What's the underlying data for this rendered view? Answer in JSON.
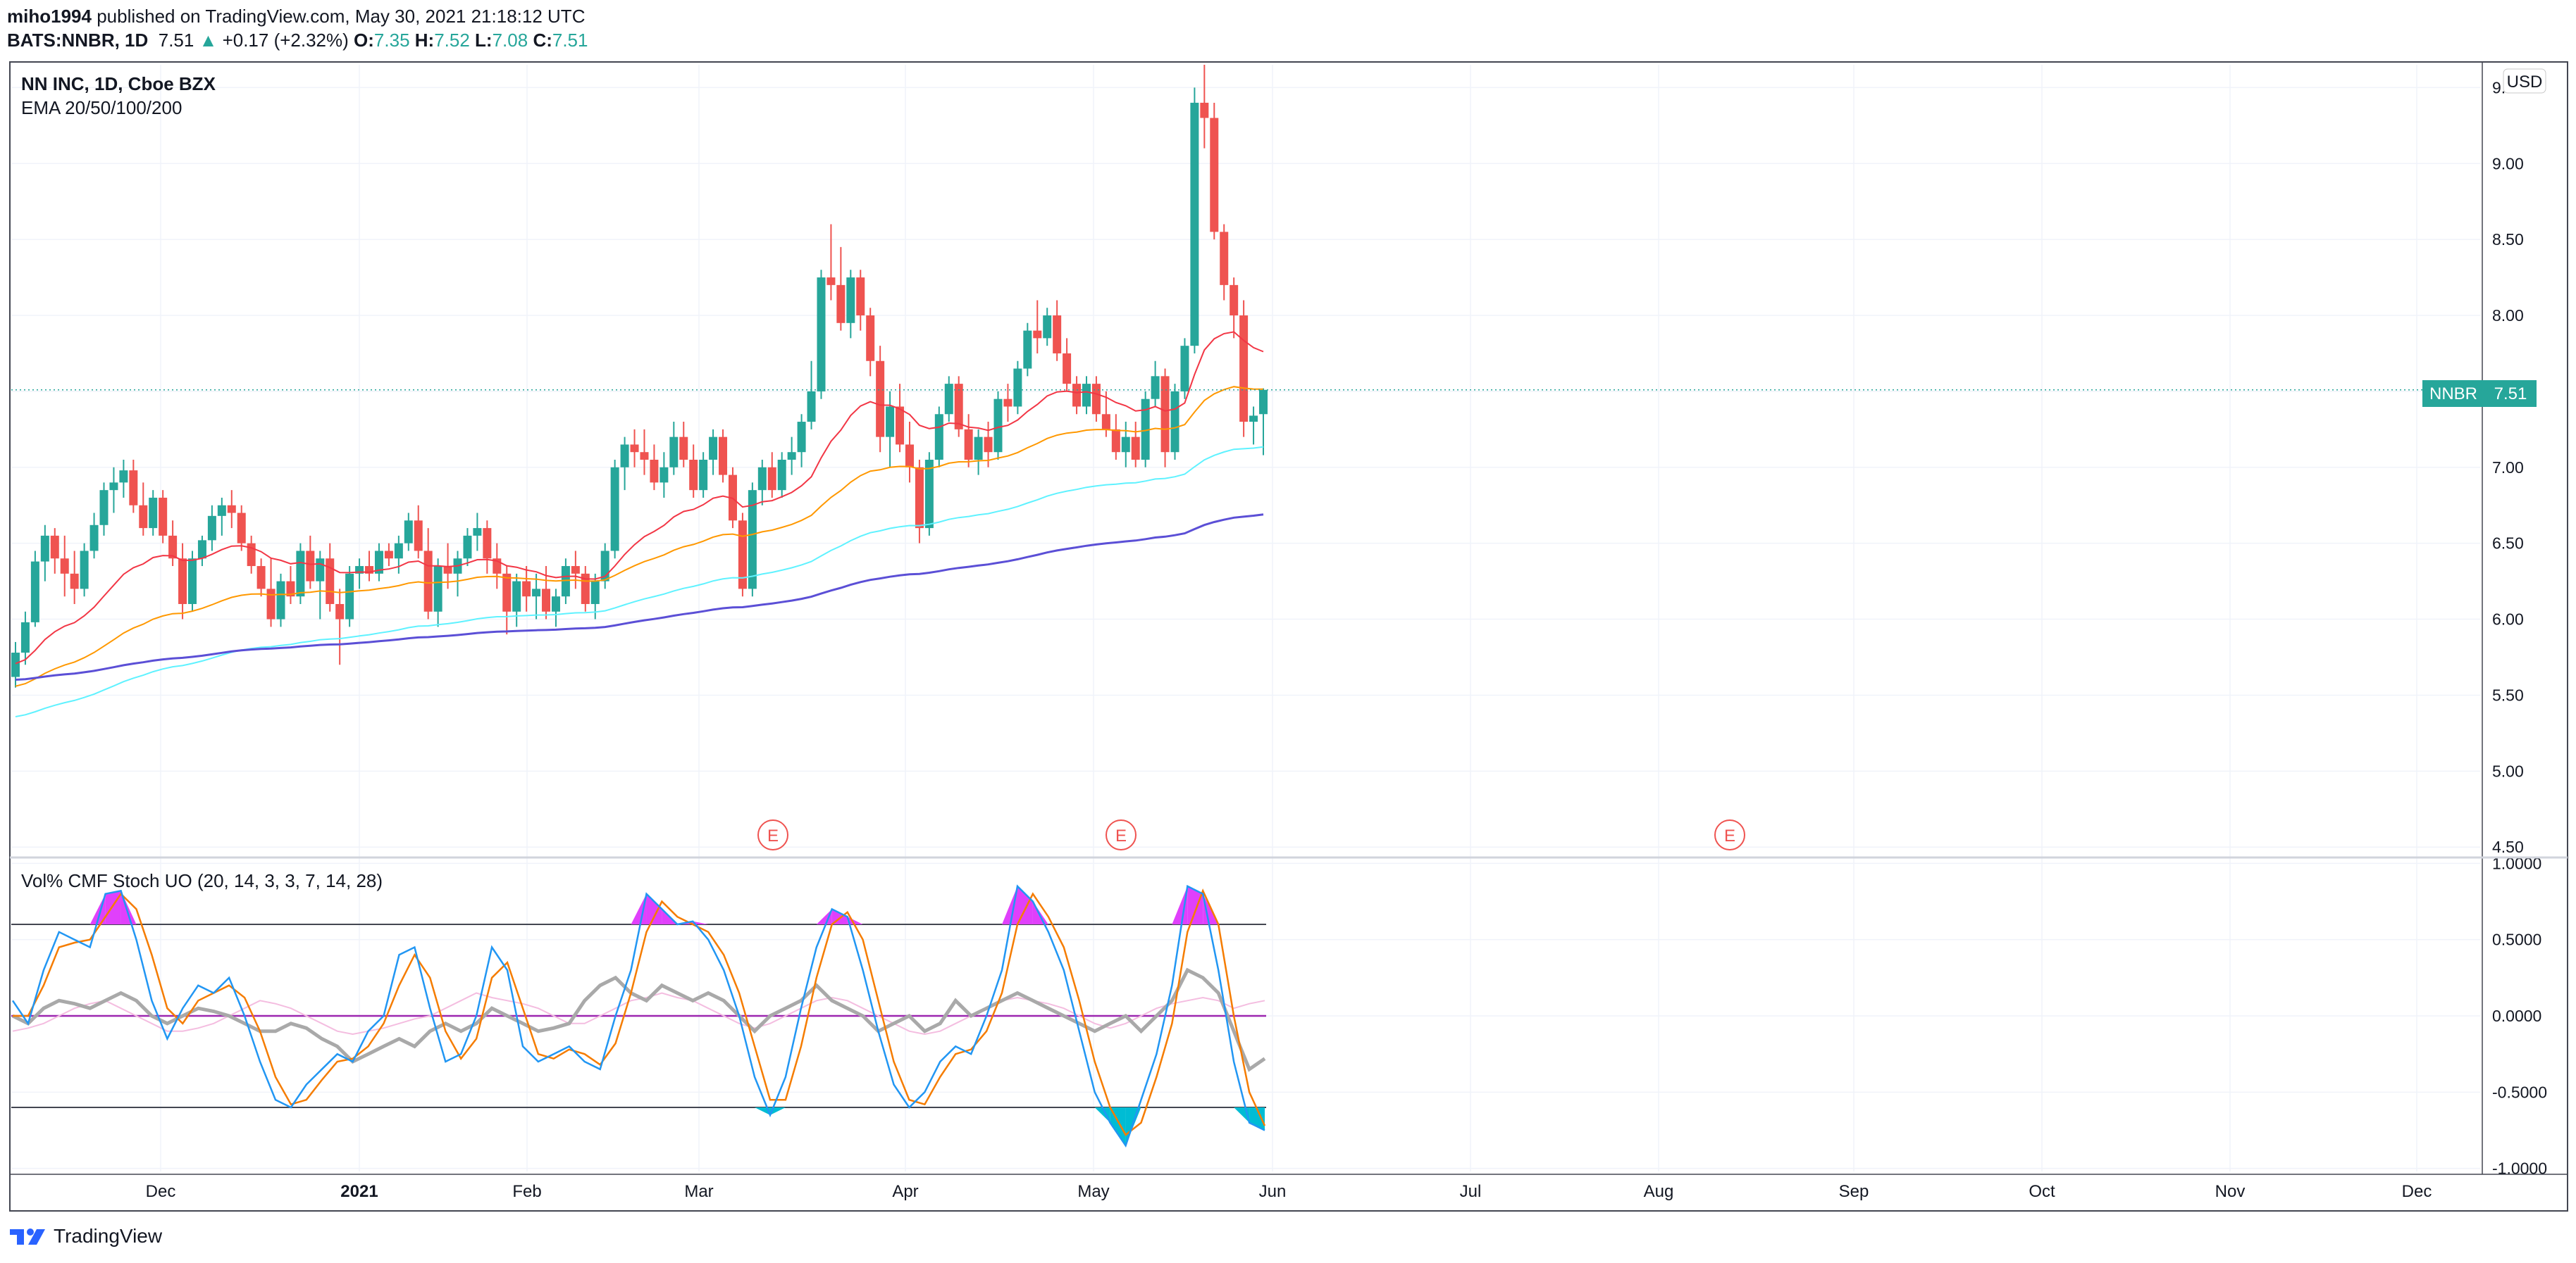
{
  "header": {
    "author": "miho1994",
    "published": "published on TradingView.com, May 30, 2021 21:18:12 UTC",
    "symbol": "BATS:NNBR, 1D",
    "last": "7.51",
    "arrow": "▲",
    "change": "+0.17 (+2.32%)",
    "o_label": "O:",
    "o_value": "7.35",
    "h_label": "H:",
    "h_value": "7.52",
    "l_label": "L:",
    "l_value": "7.08",
    "c_label": "C:",
    "c_value": "7.51"
  },
  "legend": {
    "title": "NN INC, 1D, Cboe BZX",
    "indicator": "EMA 20/50/100/200",
    "oscillator": "Vol% CMF Stoch UO (20, 14, 3, 3, 7, 14, 28)"
  },
  "currency": "USD",
  "price_tag": {
    "symbol": "NNBR",
    "value": "7.51"
  },
  "footer": {
    "brand": "TradingView"
  },
  "colors": {
    "up": "#26a69a",
    "down": "#ef5350",
    "ema20": "#f23645",
    "ema50": "#ff9800",
    "ema100": "#5ff2ff",
    "ema200": "#5b4fd6",
    "stoch_k": "#2196f3",
    "stoch_d": "#f57c00",
    "uo": "#a9a9a9",
    "cmf": "#f4bde0",
    "zero": "#9c27b0",
    "band": "#787b86",
    "overbought": "#e040fb",
    "oversold": "#00bcd4"
  },
  "chart_data": [
    {
      "type": "candlestick",
      "title": "NN INC, 1D, Cboe BZX",
      "y_ticks": [
        "4.50",
        "5.00",
        "5.50",
        "6.00",
        "6.50",
        "7.00",
        "7.50",
        "8.00",
        "8.50",
        "9.00",
        "9.50"
      ],
      "x_ticks": [
        "Dec",
        "2021",
        "Feb",
        "Mar",
        "Apr",
        "May",
        "Jun",
        "Jul",
        "Aug",
        "Sep",
        "Oct",
        "Nov",
        "Dec"
      ],
      "ylim": [
        4.45,
        9.65
      ],
      "earnings_markers": {
        "label": "E",
        "dates": [
          "2021-03-12",
          "2021-05-06",
          "2021-08-12"
        ]
      },
      "last_price": 7.51,
      "candles_approx": [
        [
          5.62,
          5.85,
          5.55,
          5.78
        ],
        [
          5.78,
          6.05,
          5.7,
          5.98
        ],
        [
          5.98,
          6.45,
          5.95,
          6.38
        ],
        [
          6.38,
          6.62,
          6.25,
          6.55
        ],
        [
          6.55,
          6.6,
          6.3,
          6.4
        ],
        [
          6.4,
          6.55,
          6.15,
          6.3
        ],
        [
          6.3,
          6.45,
          6.1,
          6.2
        ],
        [
          6.2,
          6.5,
          6.15,
          6.45
        ],
        [
          6.45,
          6.7,
          6.4,
          6.62
        ],
        [
          6.62,
          6.9,
          6.55,
          6.85
        ],
        [
          6.85,
          7.0,
          6.7,
          6.9
        ],
        [
          6.9,
          7.05,
          6.8,
          6.98
        ],
        [
          6.98,
          7.05,
          6.7,
          6.75
        ],
        [
          6.75,
          6.9,
          6.55,
          6.6
        ],
        [
          6.6,
          6.85,
          6.55,
          6.8
        ],
        [
          6.8,
          6.85,
          6.5,
          6.55
        ],
        [
          6.55,
          6.65,
          6.35,
          6.4
        ],
        [
          6.4,
          6.5,
          6.0,
          6.1
        ],
        [
          6.1,
          6.45,
          6.05,
          6.4
        ],
        [
          6.4,
          6.55,
          6.35,
          6.52
        ],
        [
          6.52,
          6.75,
          6.45,
          6.68
        ],
        [
          6.68,
          6.8,
          6.55,
          6.75
        ],
        [
          6.75,
          6.85,
          6.6,
          6.7
        ],
        [
          6.7,
          6.75,
          6.45,
          6.5
        ],
        [
          6.5,
          6.55,
          6.3,
          6.35
        ],
        [
          6.35,
          6.4,
          6.15,
          6.2
        ],
        [
          6.2,
          6.4,
          5.95,
          6.0
        ],
        [
          6.0,
          6.3,
          5.95,
          6.25
        ],
        [
          6.25,
          6.35,
          6.1,
          6.15
        ],
        [
          6.15,
          6.5,
          6.1,
          6.45
        ],
        [
          6.45,
          6.55,
          6.2,
          6.25
        ],
        [
          6.25,
          6.45,
          6.0,
          6.4
        ],
        [
          6.4,
          6.5,
          6.05,
          6.1
        ],
        [
          6.1,
          6.2,
          5.7,
          6.0
        ],
        [
          6.0,
          6.35,
          5.95,
          6.3
        ],
        [
          6.3,
          6.4,
          6.2,
          6.35
        ],
        [
          6.35,
          6.45,
          6.25,
          6.3
        ],
        [
          6.3,
          6.5,
          6.25,
          6.45
        ],
        [
          6.45,
          6.5,
          6.35,
          6.4
        ],
        [
          6.4,
          6.55,
          6.3,
          6.5
        ],
        [
          6.5,
          6.7,
          6.45,
          6.65
        ],
        [
          6.65,
          6.75,
          6.4,
          6.45
        ],
        [
          6.45,
          6.6,
          6.0,
          6.05
        ],
        [
          6.05,
          6.4,
          5.95,
          6.35
        ],
        [
          6.35,
          6.5,
          6.2,
          6.3
        ],
        [
          6.3,
          6.45,
          6.15,
          6.4
        ],
        [
          6.4,
          6.6,
          6.35,
          6.55
        ],
        [
          6.55,
          6.7,
          6.45,
          6.6
        ],
        [
          6.6,
          6.65,
          6.3,
          6.4
        ],
        [
          6.4,
          6.5,
          6.2,
          6.3
        ],
        [
          6.3,
          6.35,
          5.9,
          6.05
        ],
        [
          6.05,
          6.3,
          5.95,
          6.25
        ],
        [
          6.25,
          6.35,
          6.05,
          6.15
        ],
        [
          6.15,
          6.3,
          6.0,
          6.2
        ],
        [
          6.2,
          6.35,
          6.0,
          6.05
        ],
        [
          6.05,
          6.2,
          5.95,
          6.15
        ],
        [
          6.15,
          6.4,
          6.1,
          6.35
        ],
        [
          6.35,
          6.45,
          6.2,
          6.3
        ],
        [
          6.3,
          6.35,
          6.05,
          6.1
        ],
        [
          6.1,
          6.3,
          6.0,
          6.25
        ],
        [
          6.25,
          6.5,
          6.2,
          6.45
        ],
        [
          6.45,
          7.05,
          6.4,
          7.0
        ],
        [
          7.0,
          7.2,
          6.85,
          7.15
        ],
        [
          7.15,
          7.25,
          7.0,
          7.1
        ],
        [
          7.1,
          7.25,
          6.95,
          7.05
        ],
        [
          7.05,
          7.15,
          6.85,
          6.9
        ],
        [
          6.9,
          7.1,
          6.8,
          7.0
        ],
        [
          7.0,
          7.3,
          6.95,
          7.2
        ],
        [
          7.2,
          7.3,
          7.0,
          7.05
        ],
        [
          7.05,
          7.15,
          6.8,
          6.85
        ],
        [
          6.85,
          7.1,
          6.8,
          7.05
        ],
        [
          7.05,
          7.25,
          6.95,
          7.2
        ],
        [
          7.2,
          7.25,
          6.9,
          6.95
        ],
        [
          6.95,
          7.0,
          6.6,
          6.65
        ],
        [
          6.65,
          6.7,
          6.15,
          6.2
        ],
        [
          6.2,
          6.9,
          6.15,
          6.85
        ],
        [
          6.85,
          7.05,
          6.75,
          7.0
        ],
        [
          7.0,
          7.1,
          6.8,
          6.85
        ],
        [
          6.85,
          7.1,
          6.8,
          7.05
        ],
        [
          7.05,
          7.2,
          6.95,
          7.1
        ],
        [
          7.1,
          7.35,
          7.0,
          7.3
        ],
        [
          7.3,
          7.7,
          7.25,
          7.5
        ],
        [
          7.5,
          8.3,
          7.45,
          8.25
        ],
        [
          8.25,
          8.6,
          8.1,
          8.2
        ],
        [
          8.2,
          8.45,
          7.9,
          7.95
        ],
        [
          7.95,
          8.3,
          7.85,
          8.25
        ],
        [
          8.25,
          8.3,
          7.9,
          8.0
        ],
        [
          8.0,
          8.05,
          7.6,
          7.7
        ],
        [
          7.7,
          7.8,
          7.1,
          7.2
        ],
        [
          7.2,
          7.5,
          7.0,
          7.4
        ],
        [
          7.4,
          7.55,
          7.1,
          7.15
        ],
        [
          7.15,
          7.3,
          6.9,
          7.0
        ],
        [
          7.0,
          7.05,
          6.5,
          6.6
        ],
        [
          6.6,
          7.1,
          6.55,
          7.05
        ],
        [
          7.05,
          7.4,
          7.0,
          7.35
        ],
        [
          7.35,
          7.6,
          7.3,
          7.55
        ],
        [
          7.55,
          7.6,
          7.2,
          7.25
        ],
        [
          7.25,
          7.35,
          7.0,
          7.05
        ],
        [
          7.05,
          7.25,
          6.95,
          7.2
        ],
        [
          7.2,
          7.3,
          7.0,
          7.1
        ],
        [
          7.1,
          7.5,
          7.05,
          7.45
        ],
        [
          7.45,
          7.55,
          7.3,
          7.4
        ],
        [
          7.4,
          7.7,
          7.35,
          7.65
        ],
        [
          7.65,
          7.95,
          7.6,
          7.9
        ],
        [
          7.9,
          8.1,
          7.75,
          7.85
        ],
        [
          7.85,
          8.05,
          7.8,
          8.0
        ],
        [
          8.0,
          8.1,
          7.7,
          7.75
        ],
        [
          7.75,
          7.85,
          7.5,
          7.55
        ],
        [
          7.55,
          7.6,
          7.35,
          7.4
        ],
        [
          7.4,
          7.6,
          7.35,
          7.55
        ],
        [
          7.55,
          7.6,
          7.3,
          7.35
        ],
        [
          7.35,
          7.5,
          7.2,
          7.25
        ],
        [
          7.25,
          7.35,
          7.05,
          7.1
        ],
        [
          7.1,
          7.3,
          7.0,
          7.2
        ],
        [
          7.2,
          7.3,
          7.0,
          7.05
        ],
        [
          7.05,
          7.5,
          7.0,
          7.45
        ],
        [
          7.45,
          7.7,
          7.4,
          7.6
        ],
        [
          7.6,
          7.65,
          7.0,
          7.1
        ],
        [
          7.1,
          7.55,
          7.05,
          7.5
        ],
        [
          7.5,
          7.85,
          7.45,
          7.8
        ],
        [
          7.8,
          9.5,
          7.75,
          9.4
        ],
        [
          9.4,
          9.65,
          9.1,
          9.3
        ],
        [
          9.3,
          9.4,
          8.5,
          8.55
        ],
        [
          8.55,
          8.6,
          8.1,
          8.2
        ],
        [
          8.2,
          8.25,
          7.85,
          8.0
        ],
        [
          8.0,
          8.1,
          7.2,
          7.3
        ],
        [
          7.3,
          7.4,
          7.15,
          7.34
        ],
        [
          7.35,
          7.52,
          7.08,
          7.51
        ]
      ]
    },
    {
      "type": "line",
      "title": "Vol% CMF Stoch UO (20, 14, 3, 3, 7, 14, 28)",
      "y_ticks": [
        "1.0000",
        "0.5000",
        "0.0000",
        "-0.5000",
        "-1.0000"
      ],
      "ylim": [
        -1.02,
        1.02
      ],
      "levels": [
        0.6,
        0.0,
        -0.6
      ],
      "series_approx": {
        "stoch_k": [
          0.1,
          -0.05,
          0.3,
          0.55,
          0.5,
          0.45,
          0.8,
          0.82,
          0.5,
          0.1,
          -0.15,
          0.05,
          0.2,
          0.15,
          0.25,
          0.0,
          -0.3,
          -0.55,
          -0.6,
          -0.45,
          -0.35,
          -0.25,
          -0.3,
          -0.1,
          0.0,
          0.4,
          0.45,
          0.05,
          -0.3,
          -0.25,
          0.0,
          0.45,
          0.3,
          -0.2,
          -0.3,
          -0.25,
          -0.2,
          -0.3,
          -0.35,
          0.0,
          0.3,
          0.8,
          0.7,
          0.6,
          0.62,
          0.5,
          0.3,
          0.0,
          -0.4,
          -0.65,
          -0.4,
          0.05,
          0.45,
          0.7,
          0.65,
          0.3,
          -0.1,
          -0.45,
          -0.6,
          -0.5,
          -0.3,
          -0.2,
          -0.25,
          0.0,
          0.3,
          0.85,
          0.75,
          0.55,
          0.3,
          -0.1,
          -0.5,
          -0.7,
          -0.85,
          -0.55,
          -0.25,
          0.2,
          0.85,
          0.8,
          0.3,
          -0.3,
          -0.7,
          -0.75
        ],
        "stoch_d": [
          0.0,
          0.0,
          0.2,
          0.45,
          0.48,
          0.5,
          0.65,
          0.8,
          0.7,
          0.4,
          0.05,
          -0.05,
          0.1,
          0.15,
          0.2,
          0.12,
          -0.1,
          -0.4,
          -0.58,
          -0.55,
          -0.42,
          -0.3,
          -0.28,
          -0.2,
          -0.05,
          0.2,
          0.4,
          0.25,
          -0.1,
          -0.28,
          -0.15,
          0.25,
          0.35,
          0.05,
          -0.25,
          -0.28,
          -0.22,
          -0.25,
          -0.32,
          -0.18,
          0.15,
          0.55,
          0.75,
          0.65,
          0.6,
          0.55,
          0.4,
          0.15,
          -0.2,
          -0.55,
          -0.55,
          -0.2,
          0.25,
          0.6,
          0.68,
          0.5,
          0.1,
          -0.3,
          -0.55,
          -0.58,
          -0.4,
          -0.25,
          -0.22,
          -0.1,
          0.15,
          0.6,
          0.8,
          0.65,
          0.45,
          0.1,
          -0.3,
          -0.6,
          -0.78,
          -0.7,
          -0.4,
          -0.05,
          0.55,
          0.82,
          0.6,
          0.0,
          -0.5,
          -0.72
        ],
        "uo": [
          0.0,
          -0.05,
          0.05,
          0.1,
          0.08,
          0.05,
          0.1,
          0.15,
          0.1,
          0.0,
          -0.05,
          0.0,
          0.05,
          0.03,
          0.0,
          -0.05,
          -0.1,
          -0.1,
          -0.05,
          -0.08,
          -0.15,
          -0.2,
          -0.3,
          -0.25,
          -0.2,
          -0.15,
          -0.2,
          -0.1,
          -0.05,
          -0.1,
          -0.05,
          0.05,
          0.0,
          -0.05,
          -0.1,
          -0.08,
          -0.05,
          0.1,
          0.2,
          0.25,
          0.15,
          0.1,
          0.2,
          0.15,
          0.1,
          0.15,
          0.1,
          0.0,
          -0.1,
          0.0,
          0.05,
          0.1,
          0.2,
          0.1,
          0.05,
          0.0,
          -0.1,
          -0.05,
          0.0,
          -0.1,
          -0.05,
          0.1,
          0.0,
          0.05,
          0.1,
          0.15,
          0.1,
          0.05,
          0.0,
          -0.05,
          -0.1,
          -0.05,
          0.0,
          -0.1,
          0.0,
          0.1,
          0.3,
          0.25,
          0.15,
          -0.1,
          -0.35,
          -0.28
        ],
        "cmf": [
          -0.1,
          -0.08,
          -0.05,
          0.0,
          0.05,
          0.08,
          0.1,
          0.05,
          0.0,
          -0.05,
          -0.1,
          -0.1,
          -0.08,
          -0.05,
          0.0,
          0.05,
          0.1,
          0.08,
          0.05,
          0.0,
          -0.05,
          -0.1,
          -0.12,
          -0.1,
          -0.08,
          -0.05,
          -0.02,
          0.0,
          0.05,
          0.1,
          0.15,
          0.12,
          0.1,
          0.08,
          0.05,
          0.0,
          -0.05,
          -0.05,
          0.0,
          0.05,
          0.1,
          0.12,
          0.15,
          0.12,
          0.1,
          0.05,
          0.0,
          -0.05,
          -0.08,
          -0.05,
          0.0,
          0.05,
          0.1,
          0.12,
          0.1,
          0.05,
          0.0,
          -0.05,
          -0.1,
          -0.12,
          -0.1,
          -0.05,
          0.0,
          0.05,
          0.1,
          0.12,
          0.1,
          0.08,
          0.05,
          0.0,
          -0.05,
          -0.08,
          -0.05,
          0.0,
          0.05,
          0.08,
          0.1,
          0.12,
          0.1,
          0.05,
          0.08,
          0.1
        ]
      }
    }
  ]
}
